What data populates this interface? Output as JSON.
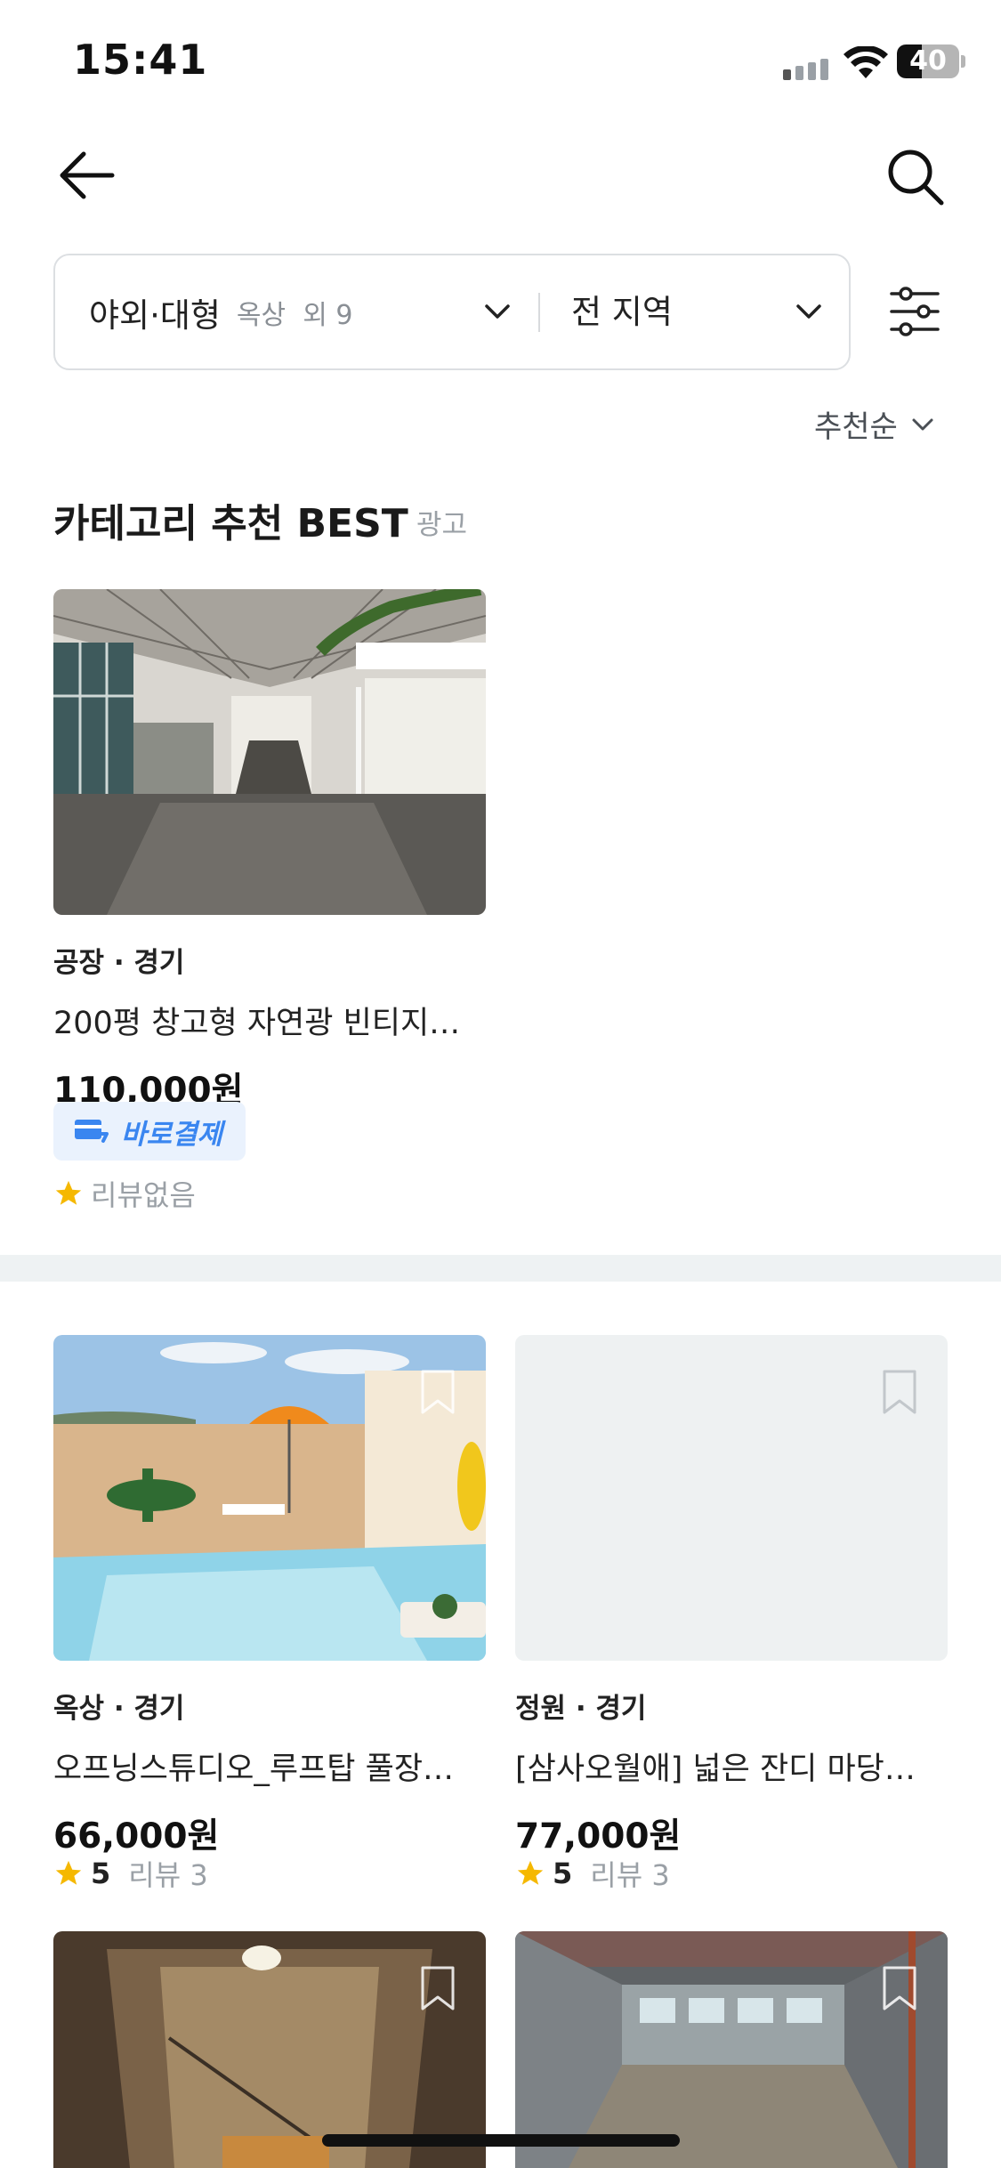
{
  "status_bar": {
    "time": "15:41",
    "battery": "40",
    "battery_level": 0.4
  },
  "header": {
    "back_icon": "arrow-left-icon",
    "search_icon": "search-icon"
  },
  "filter": {
    "category_main": "야외·대형",
    "category_sub": "옥상  외 9",
    "region": "전 지역",
    "settings_icon": "sliders-icon"
  },
  "sort": {
    "label": "추천순"
  },
  "section": {
    "title": "카테고리 추천 BEST",
    "ad_label": "광고"
  },
  "best_card": {
    "category": "공장 · 경기",
    "title": "200평 창고형 자연광 빈티지…",
    "price": "110,000원",
    "badge": "바로결제",
    "review": "리뷰없음"
  },
  "listings": [
    {
      "category": "옥상 · 경기",
      "title": "오프닝스튜디오_루프탑 풀장…",
      "price": "66,000원",
      "rating": "5",
      "review_label": "리뷰 3"
    },
    {
      "category": "정원 · 경기",
      "title": "[삼사오월애] 넓은 잔디 마당…",
      "price": "77,000원",
      "rating": "5",
      "review_label": "리뷰 3"
    }
  ],
  "colors": {
    "accent": "#3a86f0",
    "star": "#f5b800",
    "separator": "#eef2f3"
  }
}
